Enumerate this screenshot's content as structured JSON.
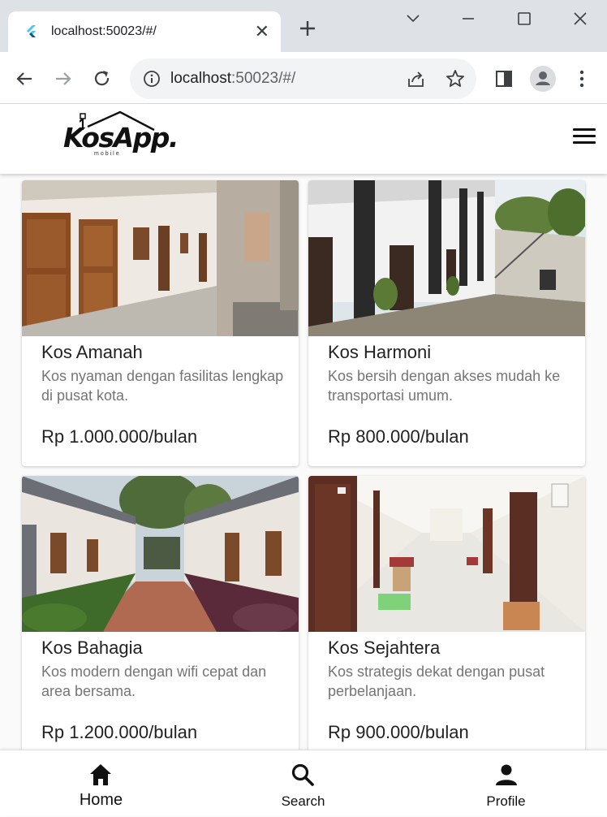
{
  "browser": {
    "tab_title": "localhost:50023/#/",
    "url_host": "localhost",
    "url_rest": ":50023/#/"
  },
  "app": {
    "logo_text": "KosApp.",
    "logo_sub": "mobile"
  },
  "listings": [
    {
      "title": "Kos Amanah",
      "description": "Kos nyaman dengan fasilitas lengkap di pusat kota.",
      "price": "Rp 1.000.000/bulan"
    },
    {
      "title": "Kos Harmoni",
      "description": "Kos bersih dengan akses mudah ke transportasi umum.",
      "price": "Rp 800.000/bulan"
    },
    {
      "title": "Kos Bahagia",
      "description": "Kos modern dengan wifi cepat dan area bersama.",
      "price": "Rp 1.200.000/bulan"
    },
    {
      "title": "Kos Sejahtera",
      "description": "Kos strategis dekat dengan pusat perbelanjaan.",
      "price": "Rp 900.000/bulan"
    }
  ],
  "bottom_nav": {
    "items": [
      {
        "label": "Home",
        "icon": "home-icon",
        "active": true
      },
      {
        "label": "Search",
        "icon": "search-icon",
        "active": false
      },
      {
        "label": "Profile",
        "icon": "person-icon",
        "active": false
      }
    ]
  },
  "colors": {
    "chrome_bg": "#dee1e6",
    "text_primary": "#222222",
    "text_secondary": "#757575"
  }
}
